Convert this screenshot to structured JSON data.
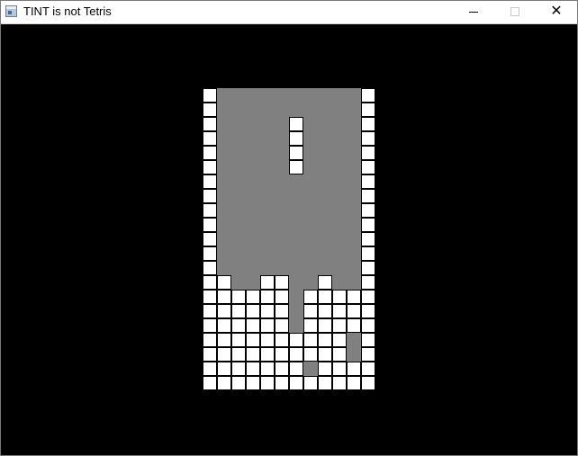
{
  "window": {
    "title": "TINT is not Tetris",
    "icon": "app-window-icon",
    "controls": {
      "minimize": "minimize-icon",
      "maximize": "maximize-icon",
      "maximize_enabled": false,
      "close": "close-icon",
      "close_glyph": "✕"
    }
  },
  "colors": {
    "background": "#000000",
    "block": "#ffffff",
    "empty": "#808080"
  },
  "board": {
    "columns": 12,
    "rows": 21,
    "legend": {
      "W": "white block (wall, stack or active piece)",
      "G": "empty gray cell",
      "K": "black gap"
    },
    "grid": [
      "WGGGGGGGGGGW",
      "WGGGGGGGGGGW",
      "WGGGGGWGGGGW",
      "WGGGGGWGGGGW",
      "WGGGGGWGGGGW",
      "WGGGGGWGGGGW",
      "WGGGGGGGGGGW",
      "WGGGGGGGGGGW",
      "WGGGGGGGGGGW",
      "WGGGGGGGGGGW",
      "WGGGGGGGGGGW",
      "WGGGGGGGGGGW",
      "WGGGGGGGGGGW",
      "WWGGWWGGWGGW",
      "WWWWWWGWWWWW",
      "WWWWWWGWWWWW",
      "WWWWWWGWWWWW",
      "WWWWWWWWWWGW",
      "WWWWWWWWWWGW",
      "WWWWWWWGWWWW",
      "WWWWWWWWWWWW"
    ]
  }
}
